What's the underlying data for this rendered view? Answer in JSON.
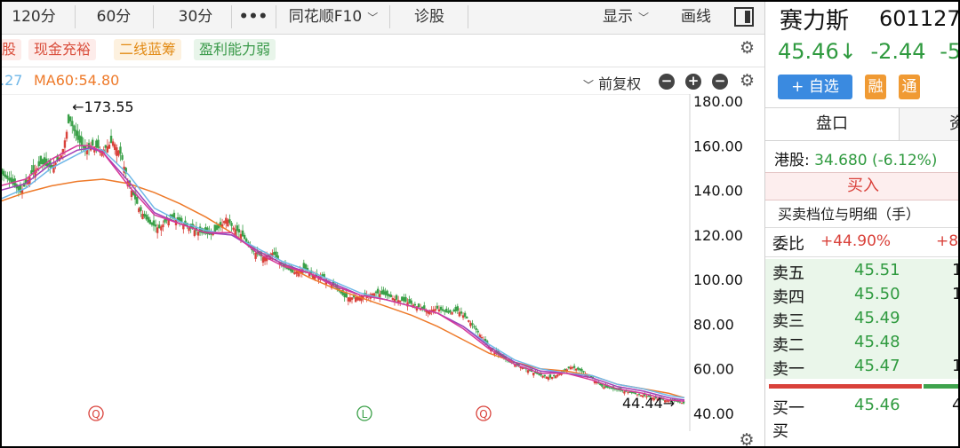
{
  "toolbar": {
    "items": [
      "120分",
      "60分",
      "30分",
      "•••",
      "同花顺F10",
      "诊股",
      "显示",
      "画线"
    ]
  },
  "tags": [
    {
      "label": "股",
      "tone": "red"
    },
    {
      "label": "现金充裕",
      "tone": "red"
    },
    {
      "label": "二线蓝筹",
      "tone": "orange"
    },
    {
      "label": "盈利能力弱",
      "tone": "green"
    }
  ],
  "ma_row": {
    "ma_partial": ".27",
    "ma60": "MA60:54.80",
    "adjust_label": "前复权"
  },
  "chart_data": {
    "type": "candlestick",
    "y_axis": {
      "labels": [
        "180.00",
        "160.00",
        "140.00",
        "120.00",
        "100.00",
        "80.00",
        "60.00",
        "40.00"
      ],
      "min": 40,
      "max": 180
    },
    "annotations": {
      "high": "173.55",
      "low": "44.44"
    },
    "markers": [
      "Q",
      "L",
      "Q"
    ],
    "close_path": [
      [
        0,
        148
      ],
      [
        4,
        144
      ],
      [
        8,
        139
      ],
      [
        12,
        147
      ],
      [
        16,
        152
      ],
      [
        20,
        150
      ],
      [
        24,
        156
      ],
      [
        27,
        172
      ],
      [
        30,
        163
      ],
      [
        33,
        158
      ],
      [
        36,
        160
      ],
      [
        40,
        158
      ],
      [
        44,
        162
      ],
      [
        47,
        156
      ],
      [
        50,
        143
      ],
      [
        54,
        132
      ],
      [
        58,
        125
      ],
      [
        62,
        123
      ],
      [
        66,
        128
      ],
      [
        70,
        126
      ],
      [
        74,
        123
      ],
      [
        78,
        121
      ],
      [
        82,
        120
      ],
      [
        86,
        124
      ],
      [
        88,
        128
      ],
      [
        90,
        124
      ],
      [
        94,
        120
      ],
      [
        98,
        113
      ],
      [
        102,
        110
      ],
      [
        106,
        112
      ],
      [
        110,
        106
      ],
      [
        114,
        103
      ],
      [
        118,
        105
      ],
      [
        122,
        102
      ],
      [
        126,
        101
      ],
      [
        130,
        97
      ],
      [
        134,
        92
      ],
      [
        138,
        92
      ],
      [
        142,
        93
      ],
      [
        146,
        94
      ],
      [
        150,
        93
      ],
      [
        154,
        91
      ],
      [
        158,
        90
      ],
      [
        162,
        88
      ],
      [
        166,
        86
      ],
      [
        170,
        87
      ],
      [
        174,
        85
      ],
      [
        178,
        86
      ],
      [
        182,
        82
      ],
      [
        186,
        76
      ],
      [
        190,
        70
      ],
      [
        194,
        66
      ],
      [
        198,
        63
      ],
      [
        202,
        61
      ],
      [
        206,
        59
      ],
      [
        210,
        57
      ],
      [
        214,
        56
      ],
      [
        218,
        58
      ],
      [
        222,
        61
      ],
      [
        226,
        59
      ],
      [
        230,
        56
      ],
      [
        234,
        52
      ],
      [
        238,
        51
      ],
      [
        242,
        50
      ],
      [
        246,
        49
      ],
      [
        250,
        48
      ],
      [
        254,
        47
      ],
      [
        258,
        46
      ],
      [
        262,
        45.5
      ],
      [
        266,
        44.44
      ]
    ],
    "ma_lines": [
      {
        "name": "MA-orange",
        "color": "#ee7a2a",
        "points": [
          [
            0,
            135
          ],
          [
            10,
            139
          ],
          [
            20,
            142
          ],
          [
            30,
            144
          ],
          [
            40,
            145
          ],
          [
            50,
            143
          ],
          [
            60,
            139
          ],
          [
            70,
            134
          ],
          [
            80,
            128
          ],
          [
            90,
            121
          ],
          [
            100,
            113
          ],
          [
            110,
            107
          ],
          [
            120,
            101
          ],
          [
            130,
            96
          ],
          [
            140,
            92
          ],
          [
            150,
            88
          ],
          [
            160,
            84
          ],
          [
            170,
            79
          ],
          [
            180,
            73
          ],
          [
            190,
            67
          ],
          [
            200,
            63
          ],
          [
            210,
            60
          ],
          [
            220,
            59
          ],
          [
            230,
            57
          ],
          [
            240,
            53
          ],
          [
            250,
            51
          ],
          [
            260,
            49
          ],
          [
            266,
            47
          ]
        ]
      },
      {
        "name": "MA-blue",
        "color": "#6fb7e8",
        "points": [
          [
            0,
            136
          ],
          [
            10,
            141
          ],
          [
            20,
            150
          ],
          [
            30,
            156
          ],
          [
            35,
            159
          ],
          [
            40,
            158
          ],
          [
            50,
            147
          ],
          [
            60,
            132
          ],
          [
            70,
            126
          ],
          [
            80,
            122
          ],
          [
            90,
            120
          ],
          [
            100,
            114
          ],
          [
            110,
            108
          ],
          [
            120,
            104
          ],
          [
            130,
            99
          ],
          [
            140,
            94
          ],
          [
            150,
            91
          ],
          [
            160,
            88
          ],
          [
            170,
            85
          ],
          [
            180,
            79
          ],
          [
            190,
            71
          ],
          [
            200,
            64
          ],
          [
            210,
            60
          ],
          [
            220,
            58
          ],
          [
            230,
            57
          ],
          [
            240,
            53
          ],
          [
            250,
            51
          ],
          [
            260,
            48
          ],
          [
            266,
            47
          ]
        ]
      },
      {
        "name": "MA-purple",
        "color": "#a23fb6",
        "points": [
          [
            0,
            140
          ],
          [
            10,
            143
          ],
          [
            20,
            152
          ],
          [
            30,
            158
          ],
          [
            35,
            159
          ],
          [
            40,
            157
          ],
          [
            50,
            144
          ],
          [
            60,
            130
          ],
          [
            70,
            125
          ],
          [
            80,
            121
          ],
          [
            90,
            120
          ],
          [
            100,
            113
          ],
          [
            110,
            107
          ],
          [
            120,
            103
          ],
          [
            130,
            98
          ],
          [
            140,
            93
          ],
          [
            150,
            91
          ],
          [
            160,
            88
          ],
          [
            170,
            85
          ],
          [
            180,
            79
          ],
          [
            190,
            70
          ],
          [
            200,
            63
          ],
          [
            210,
            59
          ],
          [
            220,
            58
          ],
          [
            230,
            56
          ],
          [
            240,
            52
          ],
          [
            250,
            50
          ],
          [
            260,
            47
          ],
          [
            266,
            46
          ]
        ]
      },
      {
        "name": "MA-magenta",
        "color": "#d6389a",
        "points": [
          [
            0,
            142
          ],
          [
            10,
            145
          ],
          [
            20,
            154
          ],
          [
            30,
            160
          ],
          [
            35,
            160
          ],
          [
            40,
            157
          ],
          [
            50,
            142
          ],
          [
            60,
            129
          ],
          [
            70,
            125
          ],
          [
            80,
            121
          ],
          [
            90,
            121
          ],
          [
            100,
            112
          ],
          [
            110,
            106
          ],
          [
            120,
            103
          ],
          [
            130,
            97
          ],
          [
            140,
            93
          ],
          [
            150,
            91
          ],
          [
            160,
            88
          ],
          [
            170,
            85
          ],
          [
            180,
            78
          ],
          [
            190,
            69
          ],
          [
            200,
            62
          ],
          [
            210,
            58
          ],
          [
            220,
            58
          ],
          [
            230,
            55
          ],
          [
            240,
            51
          ],
          [
            250,
            49
          ],
          [
            260,
            46
          ],
          [
            266,
            45.5
          ]
        ]
      }
    ]
  },
  "panel": {
    "name": "赛力斯",
    "code": "601127",
    "price": "45.46",
    "arrow": "↓",
    "change": "-2.44",
    "change_pct": "-5.",
    "fav_label": "+ 自选",
    "badge_rong": "融",
    "badge_tong": "通",
    "tabs": [
      "盘口",
      "资"
    ],
    "hk_label": "港股:",
    "hk_value": "34.680 (-6.12%)",
    "buy_label": "买入",
    "detail_title": "买卖档位与明细（手）",
    "ratio_label": "委比",
    "ratio_value": "+44.90%",
    "ratio_value2": "+8",
    "asks": [
      {
        "label": "卖五",
        "price": "45.51",
        "vol": "1"
      },
      {
        "label": "卖四",
        "price": "45.50",
        "vol": "1"
      },
      {
        "label": "卖三",
        "price": "45.49",
        "vol": ""
      },
      {
        "label": "卖二",
        "price": "45.48",
        "vol": ""
      },
      {
        "label": "卖一",
        "price": "45.47",
        "vol": "1"
      }
    ],
    "bid1_label": "买一",
    "bid1_price": "45.46",
    "bid1_vol": "4",
    "bid2_label": "买"
  },
  "colors": {
    "up": "#d9413a",
    "down": "#2f9a3f",
    "accent": "#3a8ae0"
  }
}
